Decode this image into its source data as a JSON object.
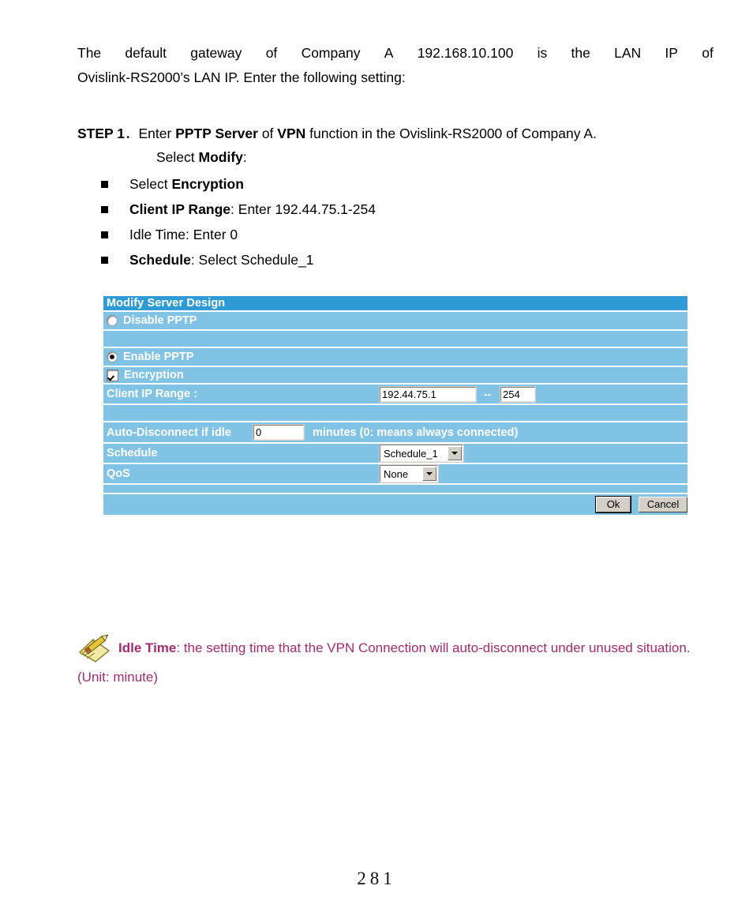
{
  "document": {
    "intro": {
      "line1_words": [
        "The",
        "default",
        "gateway",
        "of",
        "Company",
        "A",
        "192.168.10.100",
        "is",
        "the",
        "LAN",
        "IP",
        "of"
      ],
      "line2": "Ovislink-RS2000’s LAN IP. Enter the following setting:"
    },
    "step": {
      "label": "STEP 1",
      "separator": "．",
      "line1_a": "Enter ",
      "line1_b": "PPTP Server",
      "line1_c": " of ",
      "line1_d": "VPN",
      "line1_e": " function in the Ovislink-RS2000 of Company A.",
      "line2_a": "Select ",
      "line2_b": "Modify",
      "line2_c": ":"
    },
    "bullets": [
      {
        "plain_before": "Select ",
        "bold": "Encryption",
        "plain_after": ""
      },
      {
        "plain_before": "",
        "bold": "Client IP Range",
        "plain_after": ": Enter 192.44.75.1-254"
      },
      {
        "plain_before": "Idle Time: Enter 0",
        "bold": "",
        "plain_after": ""
      },
      {
        "plain_before": "",
        "bold": "Schedule",
        "plain_after": ": Select Schedule_1"
      }
    ],
    "note": {
      "bold": "Idle Time",
      "rest": ": the setting time that the VPN Connection will auto-disconnect under unused situation. (Unit: minute)",
      "icon": "pencil-notepad-icon",
      "color": "#a52a6e"
    },
    "page_number": "281"
  },
  "panel": {
    "title": "Modify Server Design",
    "colors": {
      "title_bar": "#2e9bd6",
      "row_background": "#80c3e4",
      "row_separator": "#ffffff",
      "label_text": "#ffffff"
    },
    "rows": {
      "disable_pptp": {
        "label": "Disable PPTP",
        "selected": false,
        "control": "radio"
      },
      "enable_pptp": {
        "label": "Enable PPTP",
        "selected": true,
        "control": "radio"
      },
      "encryption": {
        "label": "Encryption",
        "checked": true,
        "control": "checkbox"
      },
      "client_ip_range": {
        "label": "Client IP Range :",
        "start_value": "192.44.75.1",
        "separator": "--",
        "end_value": "254"
      },
      "auto_disconnect": {
        "label_before": "Auto-Disconnect if idle",
        "value": "0",
        "label_after": "minutes (0: means always connected)"
      },
      "schedule": {
        "label": "Schedule",
        "selected_option": "Schedule_1"
      },
      "qos": {
        "label": "QoS",
        "selected_option": "None"
      }
    },
    "buttons": {
      "ok": "Ok",
      "cancel": "Cancel"
    }
  }
}
